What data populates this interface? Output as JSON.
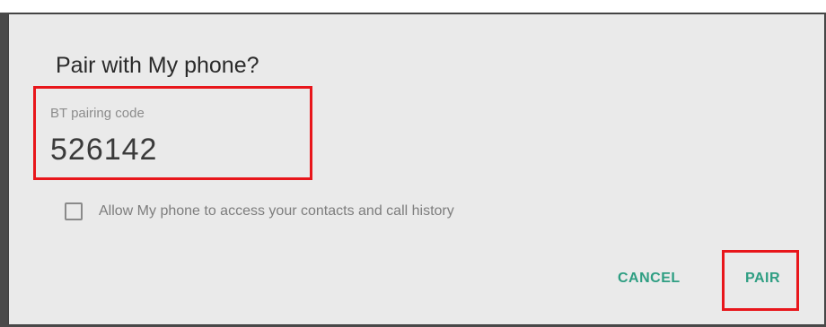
{
  "dialog": {
    "title": "Pair with My phone?",
    "code_label": "BT pairing code",
    "code_value": "526142",
    "checkbox": {
      "label": "Allow My phone to access your contacts and call history",
      "checked": false
    },
    "buttons": {
      "cancel": "CANCEL",
      "pair": "PAIR"
    }
  },
  "colors": {
    "accent": "#2e9e82",
    "highlight": "#e8161b",
    "dialog_bg": "#eaeaea",
    "title_text": "#2a2a2a",
    "secondary_text": "#8c8c8c"
  }
}
